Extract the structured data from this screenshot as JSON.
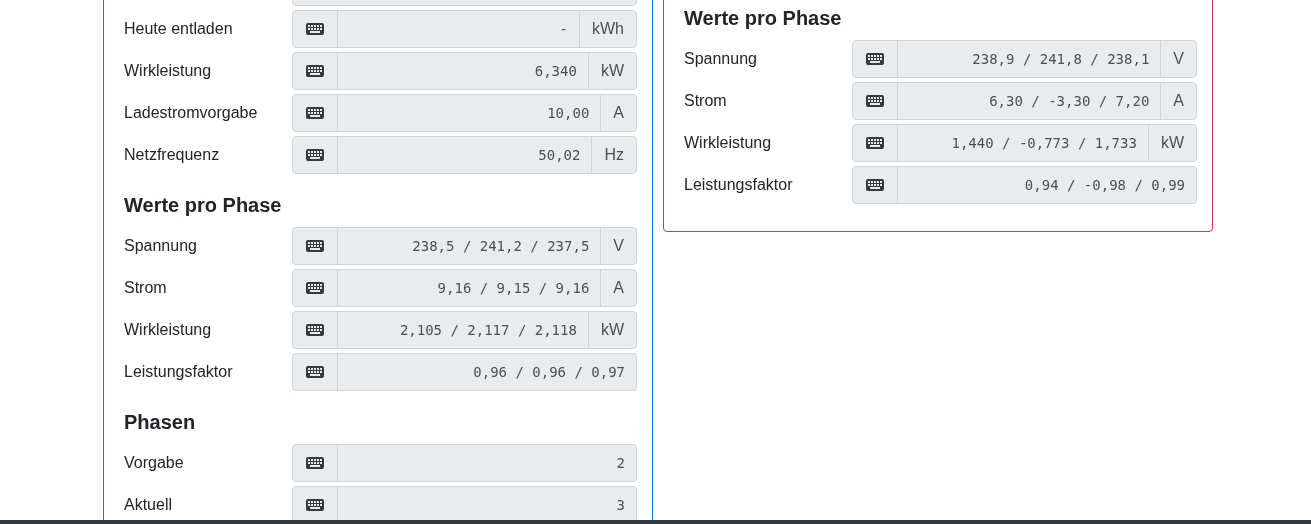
{
  "left_panel": {
    "groups": [
      {
        "rows": [
          {
            "label": "Heute entladen",
            "value": "-",
            "unit": "kWh"
          },
          {
            "label": "Wirkleistung",
            "value": "6,340",
            "unit": "kW"
          },
          {
            "label": "Ladestromvorgabe",
            "value": "10,00",
            "unit": "A"
          },
          {
            "label": "Netzfrequenz",
            "value": "50,02",
            "unit": "Hz"
          }
        ]
      },
      {
        "heading": "Werte pro Phase",
        "rows": [
          {
            "label": "Spannung",
            "value": "238,5 / 241,2 / 237,5",
            "unit": "V"
          },
          {
            "label": "Strom",
            "value": "9,16 / 9,15 / 9,16",
            "unit": "A"
          },
          {
            "label": "Wirkleistung",
            "value": "2,105 / 2,117 / 2,118",
            "unit": "kW"
          },
          {
            "label": "Leistungsfaktor",
            "value": "0,96 / 0,96 / 0,97"
          }
        ]
      },
      {
        "heading": "Phasen",
        "rows": [
          {
            "label": "Vorgabe",
            "value": "2"
          },
          {
            "label": "Aktuell",
            "value": "3"
          }
        ]
      }
    ]
  },
  "right_panel": {
    "groups": [
      {
        "heading": "Werte pro Phase",
        "rows": [
          {
            "label": "Spannung",
            "value": "238,9 / 241,8 / 238,1",
            "unit": "V"
          },
          {
            "label": "Strom",
            "value": "6,30 / -3,30 / 7,20",
            "unit": "A"
          },
          {
            "label": "Wirkleistung",
            "value": "1,440 / -0,773 / 1,733",
            "unit": "kW"
          },
          {
            "label": "Leistungsfaktor",
            "value": "0,94 / -0,98 / 0,99"
          }
        ]
      }
    ]
  }
}
